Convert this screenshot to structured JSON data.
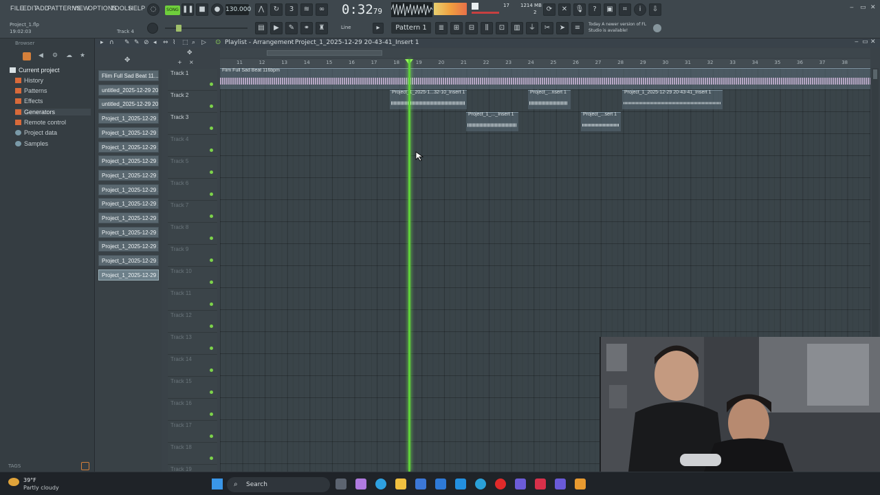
{
  "menu": [
    "FILE",
    "EDIT",
    "ADD",
    "PATTERNS",
    "VIEW",
    "OPTIONS",
    "TOOLS",
    "HELP"
  ],
  "project_file": "Project_1.flp",
  "project_time": "19:02:03",
  "hint_track": "Track 4",
  "tempo": "130.000",
  "song_time_main": "0:32",
  "song_time_frac": "79",
  "cpu": "17",
  "memory": "1214 MB",
  "polyphony": "2",
  "snap": "Line",
  "pattern": "Pattern 1",
  "update_notice": "Today  A newer version of FL Studio is available!",
  "browser": {
    "title": "Browser",
    "tags_label": "TAGS",
    "items": [
      {
        "label": "Current project",
        "color": "#d9e1e4"
      },
      {
        "label": "History",
        "color": "#d86a3a"
      },
      {
        "label": "Patterns",
        "color": "#d86a3a"
      },
      {
        "label": "Effects",
        "color": "#d86a3a"
      },
      {
        "label": "Generators",
        "color": "#d86a3a"
      },
      {
        "label": "Remote control",
        "color": "#d86a3a"
      },
      {
        "label": "Project data",
        "color": "#7a9aa8"
      },
      {
        "label": "Samples",
        "color": "#7a9aa8"
      }
    ]
  },
  "playlist": {
    "title": "Playlist - Arrangement",
    "breadcrumb": "Project_1_2025-12-29 20-43-41_Insert 1"
  },
  "patterns": [
    "Flim Full Sad Beat 11...",
    "untitled_2025-12-29 20-...",
    "untitled_2025-12-29 20-...",
    "Project_1_2025-12-29 2...",
    "Project_1_2025-12-29 2...",
    "Project_1_2025-12-29 2...",
    "Project_1_2025-12-29 2...",
    "Project_1_2025-12-29 2...",
    "Project_1_2025-12-29 2...",
    "Project_1_2025-12-29 2...",
    "Project_1_2025-12-29 2...",
    "Project_1_2025-12-29 2...",
    "Project_1_2025-12-29 2...",
    "Project_1_2025-12-29 2...",
    "Project_1_2025-12-29 2..."
  ],
  "tracks": [
    "Track 1",
    "Track 2",
    "Track 3",
    "Track 4",
    "Track 5",
    "Track 6",
    "Track 7",
    "Track 8",
    "Track 9",
    "Track 10",
    "Track 11",
    "Track 12",
    "Track 13",
    "Track 14",
    "Track 15",
    "Track 16",
    "Track 17",
    "Track 18",
    "Track 19"
  ],
  "ruler_labels": [
    "11",
    "12",
    "13",
    "14",
    "15",
    "16",
    "17",
    "18",
    "19",
    "20",
    "21",
    "22",
    "23",
    "24",
    "25",
    "26",
    "27",
    "28",
    "29",
    "30",
    "31",
    "32",
    "33",
    "34",
    "35",
    "36",
    "37",
    "38"
  ],
  "clips": [
    {
      "label": "Flim Full Sad Beat 116bpm"
    },
    {
      "label": "Project_1_2025-1...32-10_Insert 1"
    },
    {
      "label": "Project_...nsert 1"
    },
    {
      "label": "Project_1_2025-12-29 20-43-41_Insert 1"
    },
    {
      "label": "Project_1_..._Insert 1"
    },
    {
      "label": "Project_...sert 1"
    }
  ],
  "weather": {
    "temp": "39°F",
    "cond": "Partly cloudy"
  },
  "taskbar_search": "Search"
}
